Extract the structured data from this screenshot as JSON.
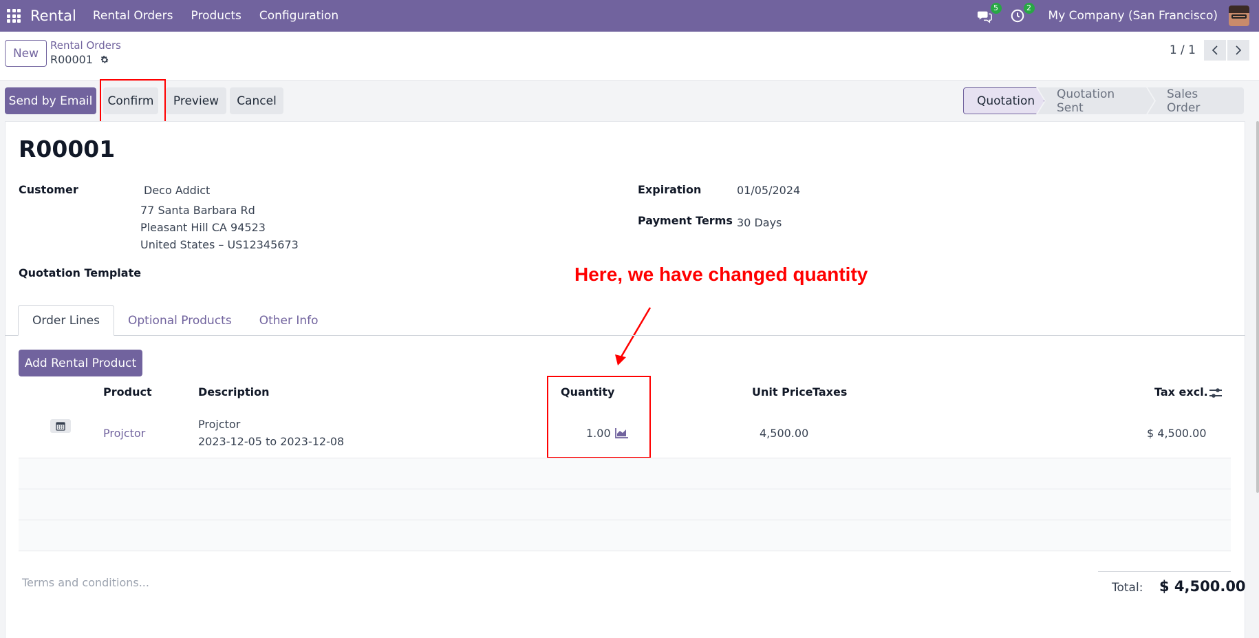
{
  "navbar": {
    "app_name": "Rental",
    "menu": [
      "Rental Orders",
      "Products",
      "Configuration"
    ],
    "messages_count": "5",
    "activities_count": "2",
    "company": "My Company (San Francisco)"
  },
  "control_panel": {
    "new_label": "New",
    "breadcrumb_parent": "Rental Orders",
    "breadcrumb_current": "R00001",
    "pager": "1 / 1"
  },
  "actions": {
    "send_by_email": "Send by Email",
    "confirm": "Confirm",
    "preview": "Preview",
    "cancel": "Cancel"
  },
  "status": {
    "stages": [
      "Quotation",
      "Quotation Sent",
      "Sales Order"
    ],
    "active": "Quotation"
  },
  "form": {
    "name": "R00001",
    "customer_label": "Customer",
    "customer_name": "Deco Addict",
    "address_line1": "77 Santa Barbara Rd",
    "address_line2": "Pleasant Hill CA 94523",
    "address_line3": "United States – US12345673",
    "quotation_template_label": "Quotation Template",
    "expiration_label": "Expiration",
    "expiration_value": "01/05/2024",
    "payment_terms_label": "Payment Terms",
    "payment_terms_value": "30 Days"
  },
  "annotation": "Here, we have changed quantity",
  "tabs": [
    "Order Lines",
    "Optional Products",
    "Other Info"
  ],
  "order_lines": {
    "add_button": "Add Rental Product",
    "columns": {
      "product": "Product",
      "description": "Description",
      "quantity": "Quantity",
      "unit_price": "Unit Price",
      "taxes": "Taxes",
      "tax_excl": "Tax excl."
    },
    "rows": [
      {
        "product": "Projctor",
        "description_line1": "Projctor",
        "description_line2": "2023-12-05 to 2023-12-08",
        "quantity": "1.00",
        "unit_price": "4,500.00",
        "taxes": "",
        "subtotal": "$ 4,500.00"
      }
    ]
  },
  "footer": {
    "terms_placeholder": "Terms and conditions...",
    "total_label": "Total:",
    "total_value": "$ 4,500.00"
  },
  "colors": {
    "brand": "#71639e",
    "annotation": "#ff0000",
    "badge": "#28a745"
  }
}
